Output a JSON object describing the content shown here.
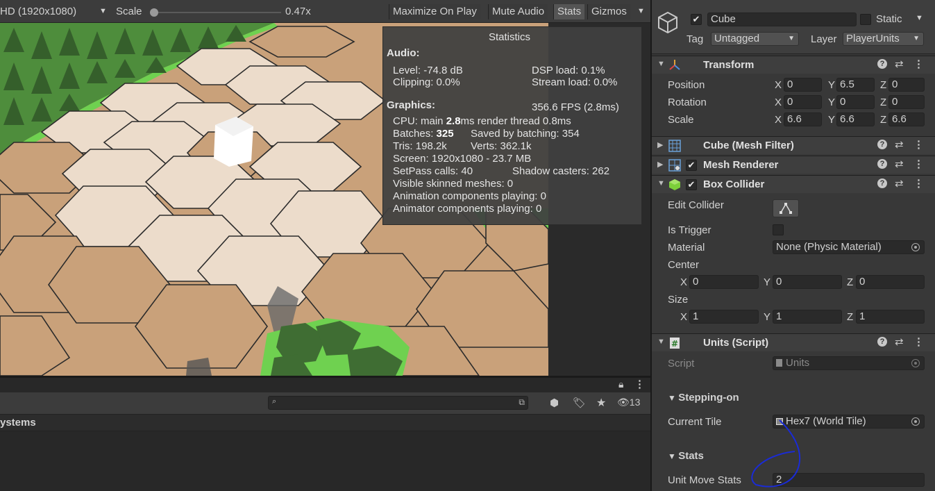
{
  "game_toolbar": {
    "resolution": "HD (1920x1080)",
    "scale_label": "Scale",
    "scale_value": "0.47x",
    "buttons": [
      "Maximize On Play",
      "Mute Audio",
      "Stats",
      "Gizmos"
    ]
  },
  "stats": {
    "title": "Statistics",
    "audio_header": "Audio:",
    "level": "Level: -74.8 dB",
    "dsp_load": "DSP load: 0.1%",
    "clipping": "Clipping: 0.0%",
    "stream_load": "Stream load: 0.0%",
    "graphics_header": "Graphics:",
    "fps": "356.6 FPS (2.8ms)",
    "cpu_prefix": "CPU: main ",
    "cpu_main": "2.8",
    "cpu_suffix": "ms  render thread 0.8ms",
    "batches_prefix": "Batches: ",
    "batches": "325",
    "saved_batching": "Saved by batching: 354",
    "tris": "Tris: 198.2k",
    "verts": "Verts: 362.1k",
    "screen": "Screen: 1920x1080 - 23.7 MB",
    "setpass": "SetPass calls: 40",
    "shadow_casters": "Shadow casters: 262",
    "skinned": "Visible skinned meshes: 0",
    "animation": "Animation components playing: 0",
    "animator": "Animator components playing: 0"
  },
  "hierarchy": {
    "search_placeholder": "",
    "count": "13",
    "row_label": "ystems"
  },
  "inspector": {
    "object_name": "Cube",
    "static_label": "Static",
    "tag_label": "Tag",
    "tag_value": "Untagged",
    "layer_label": "Layer",
    "layer_value": "PlayerUnits",
    "transform": {
      "title": "Transform",
      "rows": [
        {
          "label": "Position",
          "x": "0",
          "y": "6.5",
          "z": "0"
        },
        {
          "label": "Rotation",
          "x": "0",
          "y": "0",
          "z": "0"
        },
        {
          "label": "Scale",
          "x": "6.6",
          "y": "6.6",
          "z": "6.6"
        }
      ]
    },
    "mesh_filter_title": "Cube (Mesh Filter)",
    "mesh_renderer_title": "Mesh Renderer",
    "box_collider": {
      "title": "Box Collider",
      "edit_collider": "Edit Collider",
      "is_trigger": "Is Trigger",
      "material_label": "Material",
      "material_value": "None (Physic Material)",
      "center_label": "Center",
      "center": {
        "x": "0",
        "y": "0",
        "z": "0"
      },
      "size_label": "Size",
      "size": {
        "x": "1",
        "y": "1",
        "z": "1"
      }
    },
    "units_script": {
      "title": "Units (Script)",
      "script_label": "Script",
      "script_value": "Units",
      "stepping_header": "Stepping-on",
      "current_tile_label": "Current Tile",
      "current_tile_value": "Hex7 (World Tile)",
      "stats_header": "Stats",
      "unit_move_label": "Unit Move Stats",
      "unit_move_value": "2"
    },
    "axis": {
      "x": "X",
      "y": "Y",
      "z": "Z"
    }
  },
  "colors": {
    "hex_light": "#ecdccb",
    "hex_dark": "#c9a17a",
    "grass": "#6fd150",
    "tree": "#3f6d33"
  }
}
